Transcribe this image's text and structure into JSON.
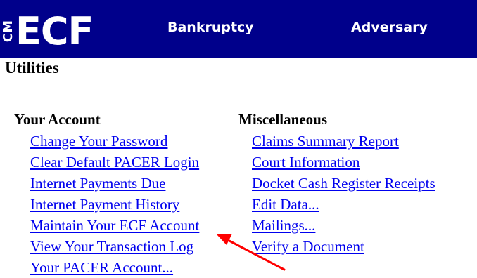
{
  "header": {
    "logo_side": "CM",
    "logo_main": "ECF",
    "menu": [
      {
        "label": "Bankruptcy"
      },
      {
        "label": "Adversary"
      }
    ],
    "background_color": "#00008b"
  },
  "page": {
    "title": "Utilities"
  },
  "sections": {
    "your_account": {
      "heading": "Your Account",
      "links": [
        "Change Your Password",
        "Clear Default PACER Login",
        "Internet Payments Due",
        "Internet Payment History",
        "Maintain Your ECF Account",
        "View Your Transaction Log",
        "Your PACER Account..."
      ]
    },
    "miscellaneous": {
      "heading": "Miscellaneous",
      "links": [
        "Claims Summary Report",
        "Court Information",
        "Docket Cash Register Receipts",
        "Edit Data...",
        "Mailings...",
        "Verify a Document"
      ]
    }
  },
  "annotation": {
    "arrow_color": "#ff0000"
  },
  "colors": {
    "link": "#0000ee"
  }
}
